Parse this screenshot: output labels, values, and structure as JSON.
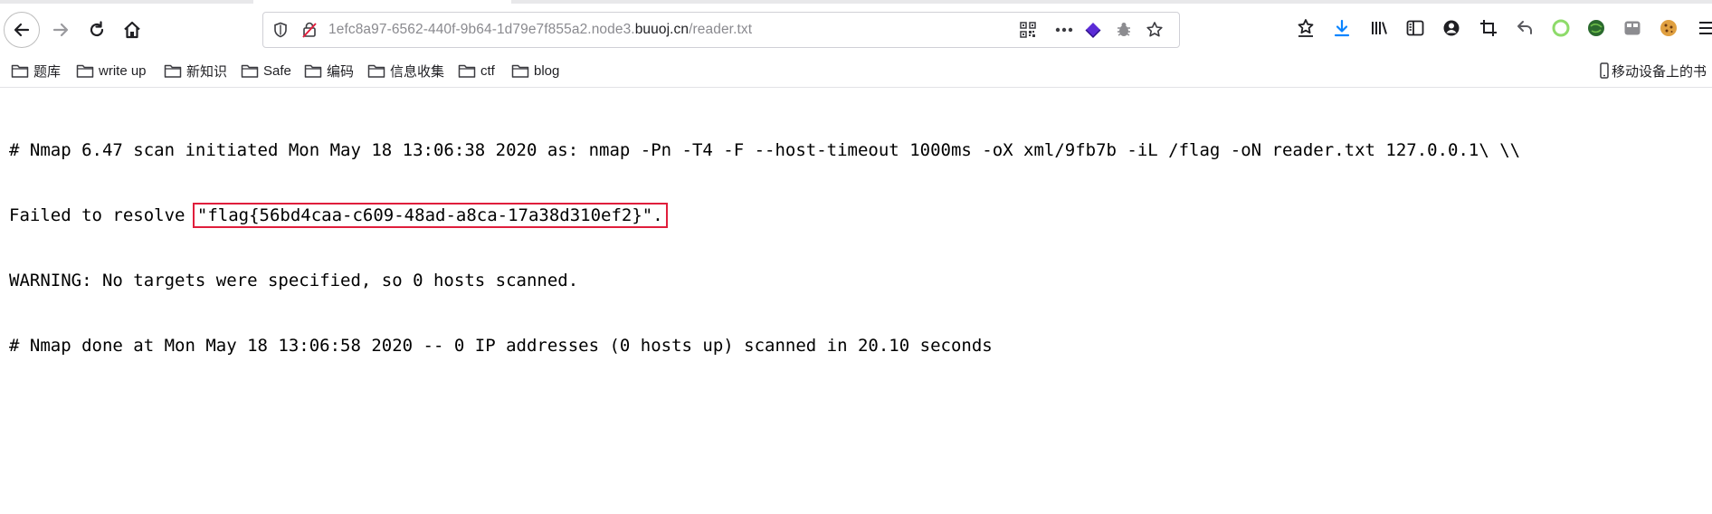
{
  "browser": {
    "url": {
      "prefix": "1efc8a97-6562-440f-9b64-1d79e7f855a2.node3.",
      "domain": "buuoj.cn",
      "path": "/reader.txt"
    },
    "icons": {
      "nav": [
        "back-icon",
        "forward-icon",
        "reload-icon",
        "home-icon"
      ],
      "urlbar": [
        "shield-icon",
        "insecure-lock-icon",
        "qr-code-icon",
        "more-icon",
        "layers-extension-icon",
        "bug-extension-icon",
        "bookmark-star-icon"
      ],
      "toolbar": [
        "reading-list-icon",
        "download-icon",
        "library-icon",
        "sidebar-icon",
        "account-icon",
        "crop-icon",
        "undo-icon",
        "green-ring-icon",
        "green-ball-icon",
        "container-icon",
        "cookie-icon",
        "menu-icon"
      ]
    }
  },
  "bookmarks": {
    "items": [
      {
        "label": "题库"
      },
      {
        "label": "write up"
      },
      {
        "label": "新知识"
      },
      {
        "label": "Safe"
      },
      {
        "label": "编码"
      },
      {
        "label": "信息收集"
      },
      {
        "label": "ctf"
      },
      {
        "label": "blog"
      }
    ],
    "mobile_label": "移动设备上的书"
  },
  "content": {
    "line1": "# Nmap 6.47 scan initiated Mon May 18 13:06:38 2020 as: nmap -Pn -T4 -F --host-timeout 1000ms -oX xml/9fb7b -iL /flag -oN reader.txt 127.0.0.1\\ \\\\",
    "line2_prefix": "Failed to resolve ",
    "line2_flag": "\"flag{56bd4caa-c609-48ad-a8ca-17a38d310ef2}\".",
    "line3": "WARNING: No targets were specified, so 0 hosts scanned.",
    "line4": "# Nmap done at Mon May 18 13:06:58 2020 -- 0 IP addresses (0 hosts up) scanned in 20.10 seconds"
  },
  "colors": {
    "highlight_box": "#e01e3c",
    "download_icon": "#0a84ff",
    "extension_purple": "#5b2bd6"
  }
}
